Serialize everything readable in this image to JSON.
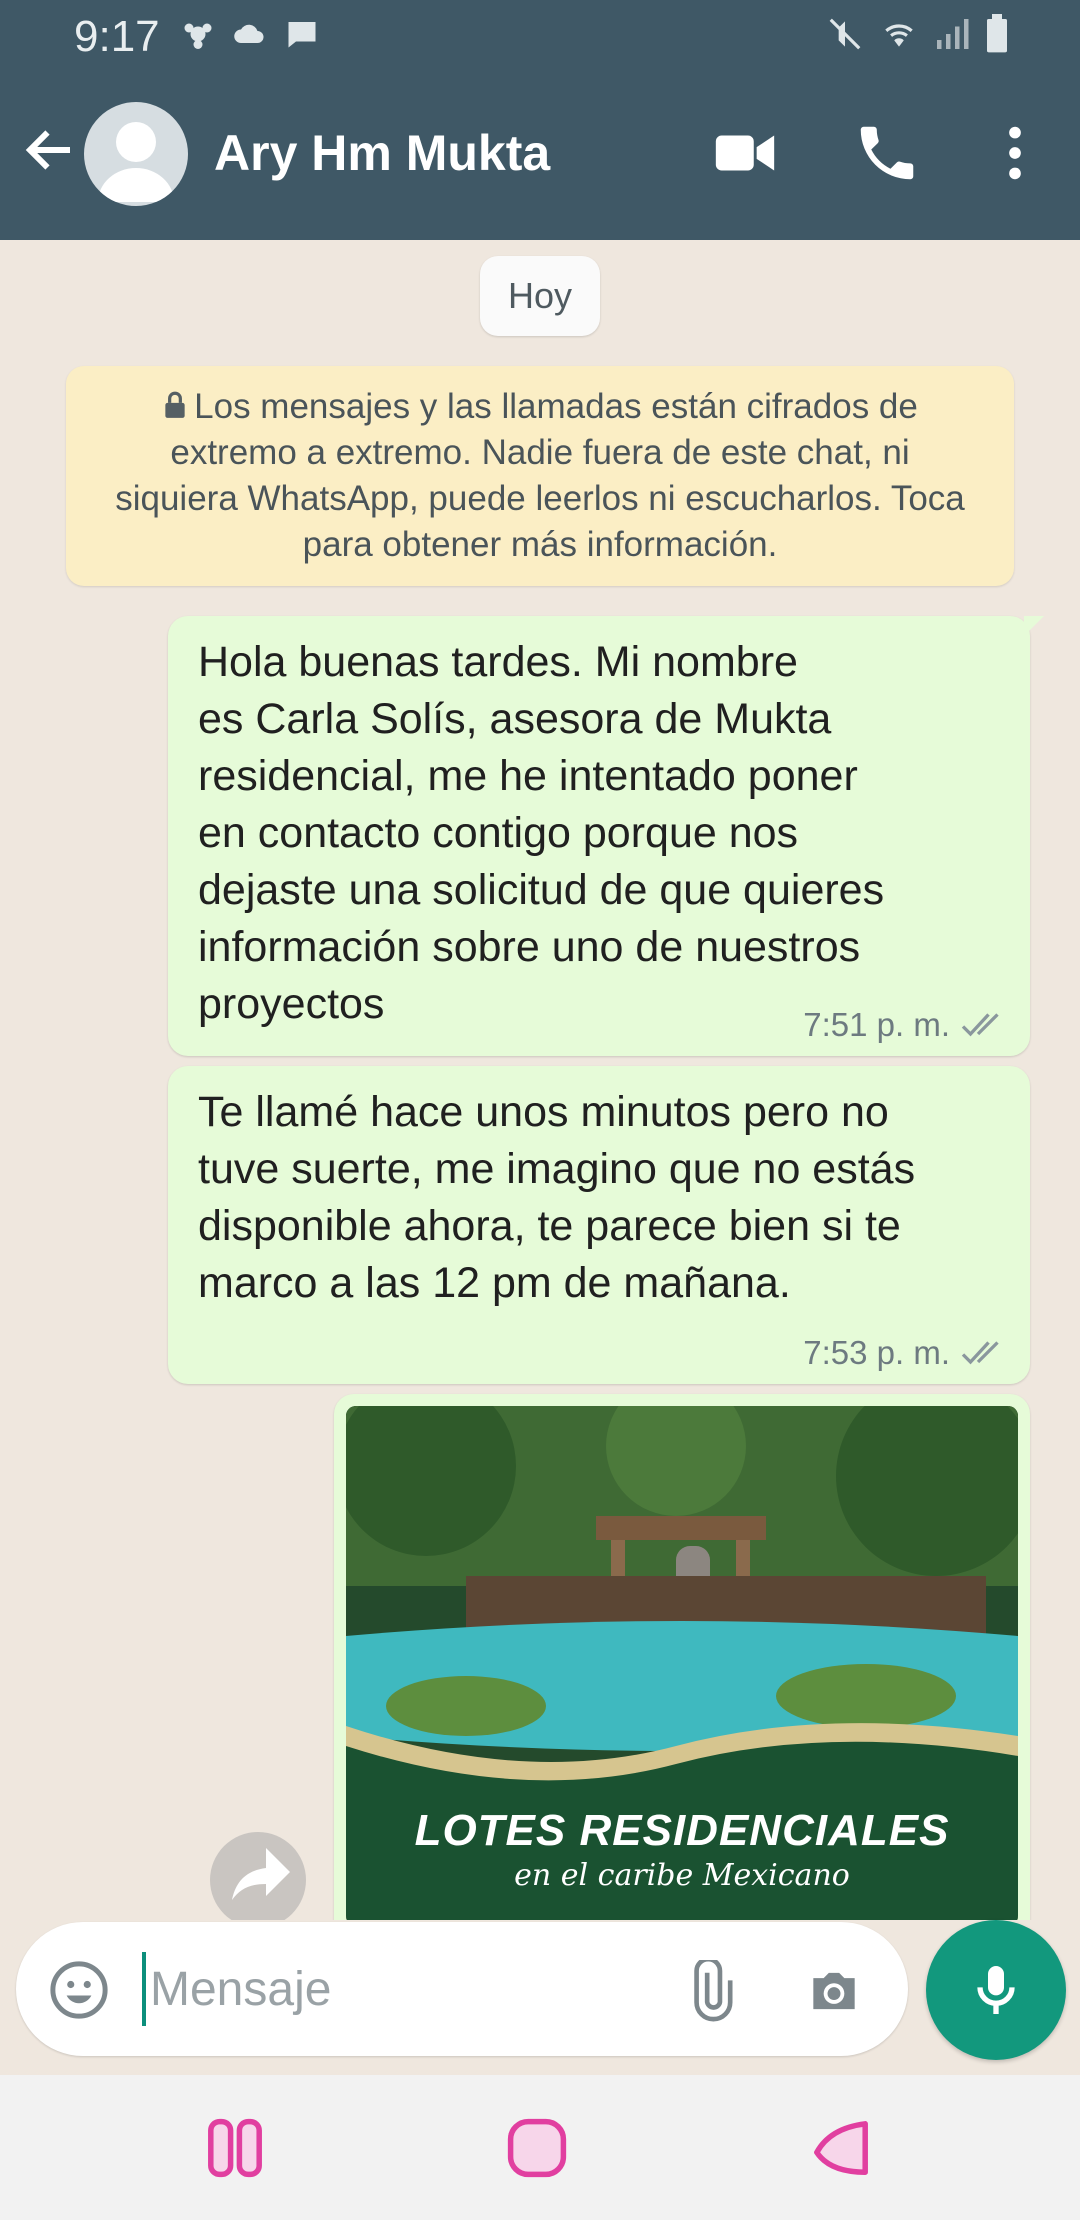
{
  "status_bar": {
    "time": "9:17"
  },
  "header": {
    "contact_name": "Ary Hm Mukta",
    "icons": [
      "back-arrow-icon",
      "avatar",
      "video-call-icon",
      "phone-icon",
      "more-vert-icon"
    ]
  },
  "chat": {
    "day_label": "Hoy",
    "encryption_notice": "Los mensajes y las llamadas están cifrados de extremo a extremo. Nadie fuera de este chat, ni siquiera WhatsApp, puede leerlos ni escucharlos. Toca para obtener más información.",
    "messages": [
      {
        "text": "Hola buenas tardes. Mi nombre\nes Carla Solís, asesora de Mukta\nresidencial, me he intentado poner\nen contacto contigo porque nos\ndejaste una solicitud de que quieres\ninformación sobre uno de nuestros\nproyectos",
        "time": "7:51 p. m."
      },
      {
        "text": "Te llamé hace unos minutos pero no\ntuve suerte, me imagino que no estás\ndisponible ahora, te parece bien si te\nmarco a las 12 pm de mañana.",
        "time": "7:53 p. m."
      }
    ],
    "image_message": {
      "title": "LOTES RESIDENCIALES",
      "subtitle": "en el caribe Mexicano"
    }
  },
  "composer": {
    "placeholder": "Mensaje"
  },
  "colors": {
    "header": "#3f5866",
    "outgoing_bubble": "#e6fbd8",
    "accent": "#12987d",
    "notice": "#fbeec5"
  }
}
